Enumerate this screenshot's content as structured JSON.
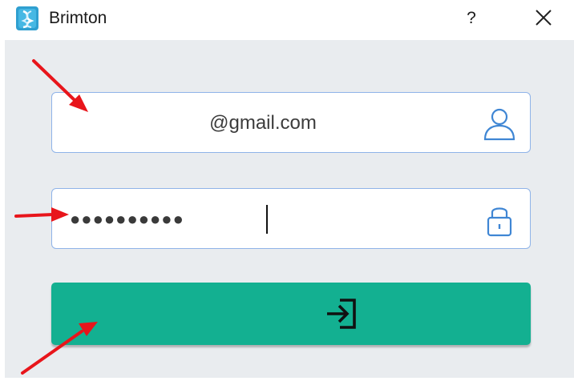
{
  "window": {
    "title": "Brimton",
    "help_label": "?",
    "close_icon": "close-icon",
    "app_icon": "brimton-logo-icon"
  },
  "login_form": {
    "email_value": "@gmail.com",
    "email_icon": "user-icon",
    "password_value": "●●●●●●●●●●",
    "password_icon": "lock-icon",
    "submit_icon": "sign-in-icon"
  },
  "colors": {
    "accent": "#13b091",
    "field_border": "#8fb3e8",
    "background": "#e9ecef",
    "annotation": "#e8151b"
  }
}
